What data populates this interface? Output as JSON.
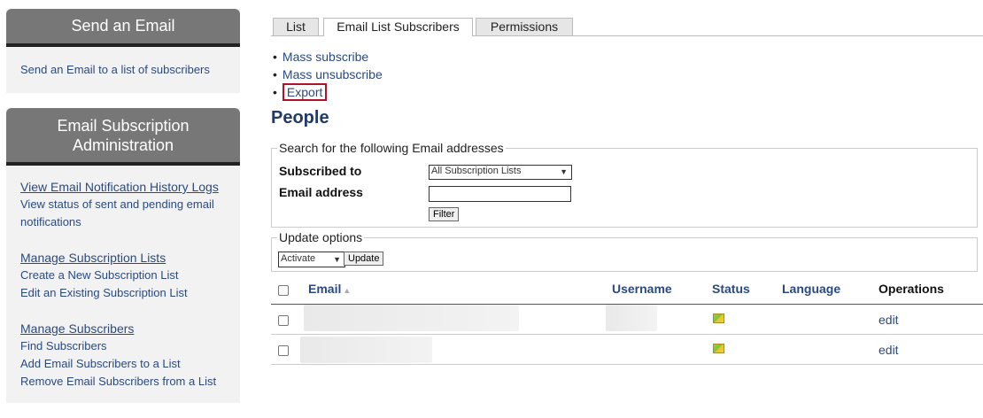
{
  "sidebar": {
    "block1": {
      "title": "Send an Email",
      "link": "Send an Email to a list of subscribers"
    },
    "block2": {
      "title": "Email Subscription Administration",
      "groups": [
        {
          "title": "View Email Notification History Logs",
          "items": [
            "View status of sent and pending email notifications"
          ]
        },
        {
          "title": "Manage Subscription Lists",
          "items": [
            "Create a New Subscription List",
            "Edit an Existing Subscription List"
          ]
        },
        {
          "title": "Manage Subscribers",
          "items": [
            "Find Subscribers",
            "Add Email Subscribers to a List",
            "Remove Email Subscribers from a List"
          ]
        }
      ]
    }
  },
  "tabs": [
    "List",
    "Email List Subscribers",
    "Permissions"
  ],
  "actions": [
    "Mass subscribe",
    "Mass unsubscribe",
    "Export"
  ],
  "page_title": "People",
  "search": {
    "legend": "Search for the following Email addresses",
    "subscribed_label": "Subscribed to",
    "subscribed_value": "All Subscription Lists",
    "email_label": "Email address",
    "email_value": "",
    "filter_label": "Filter"
  },
  "update": {
    "legend": "Update options",
    "action_value": "Activate",
    "button_label": "Update"
  },
  "table": {
    "headers": {
      "email": "Email",
      "username": "Username",
      "status": "Status",
      "language": "Language",
      "operations": "Operations"
    },
    "rows": [
      {
        "operation": "edit"
      },
      {
        "operation": "edit"
      }
    ]
  },
  "colors": {
    "link": "#2a4a7f",
    "title": "#1f3b66",
    "highlight": "#b0122b"
  }
}
